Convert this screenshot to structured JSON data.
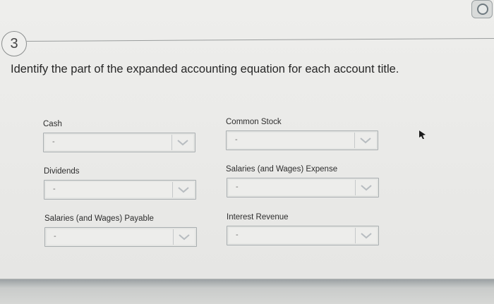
{
  "question": {
    "number": "3",
    "prompt": "Identify the part of the expanded accounting equation for each account title."
  },
  "fields": [
    {
      "label": "Cash",
      "value": "-"
    },
    {
      "label": "Common Stock",
      "value": "-"
    },
    {
      "label": "Dividends",
      "value": "-"
    },
    {
      "label": "Salaries (and Wages) Expense",
      "value": "-"
    },
    {
      "label": "Salaries (and Wages) Payable",
      "value": "-"
    },
    {
      "label": "Interest Revenue",
      "value": "-"
    }
  ],
  "icons": {
    "dropdown_arrow": "chevron-down-icon",
    "top_right": "circle-toggle-icon",
    "pointer": "mouse-pointer-icon"
  },
  "colors": {
    "page": "#ebebe9",
    "dropdown_border": "#a9aeb0",
    "chevron": "#b7bcc0"
  }
}
